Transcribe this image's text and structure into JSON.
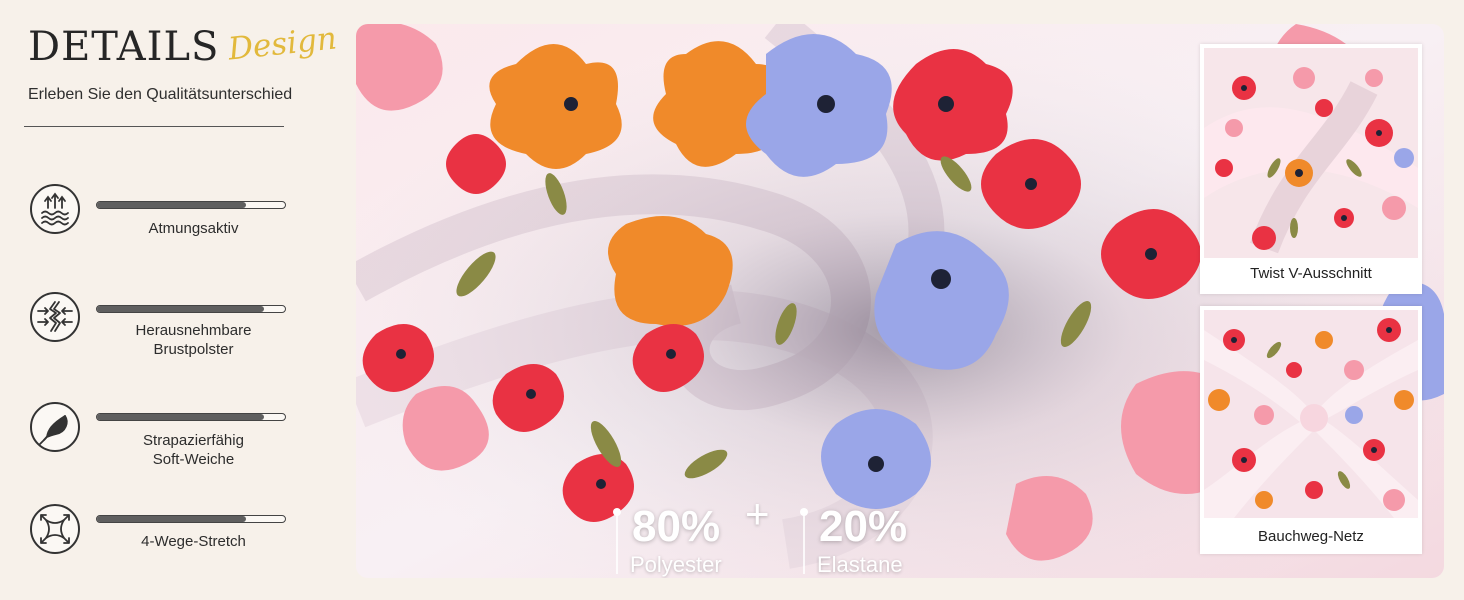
{
  "brand": {
    "title": "DETAILS",
    "script": "Design",
    "subtitle": "Erleben Sie den Qualitätsunterschied"
  },
  "features": [
    {
      "icon": "breathable-waves-icon",
      "level": 0.79,
      "label_lines": [
        "Atmungsaktiv"
      ]
    },
    {
      "icon": "compression-arrows-icon",
      "level": 0.89,
      "label_lines": [
        "Herausnehmbare",
        "Brustpolster"
      ]
    },
    {
      "icon": "feather-icon",
      "level": 0.89,
      "label_lines": [
        "Strapazierfähig",
        "Soft-Weiche"
      ]
    },
    {
      "icon": "four-way-stretch-icon",
      "level": 0.79,
      "label_lines": [
        "4-Wege-Stretch"
      ]
    }
  ],
  "composition": [
    {
      "value": "80%",
      "label": "Polyester"
    },
    {
      "value": "20%",
      "label": "Elastane"
    }
  ],
  "plus": "+",
  "thumbnails": [
    {
      "caption": "Twist V-Ausschnitt"
    },
    {
      "caption": "Bauchweg-Netz"
    }
  ],
  "colors": {
    "accent_gold": "#e2b93c",
    "bar_fill": "#5f5f5f",
    "background": "#f7f1ea"
  }
}
